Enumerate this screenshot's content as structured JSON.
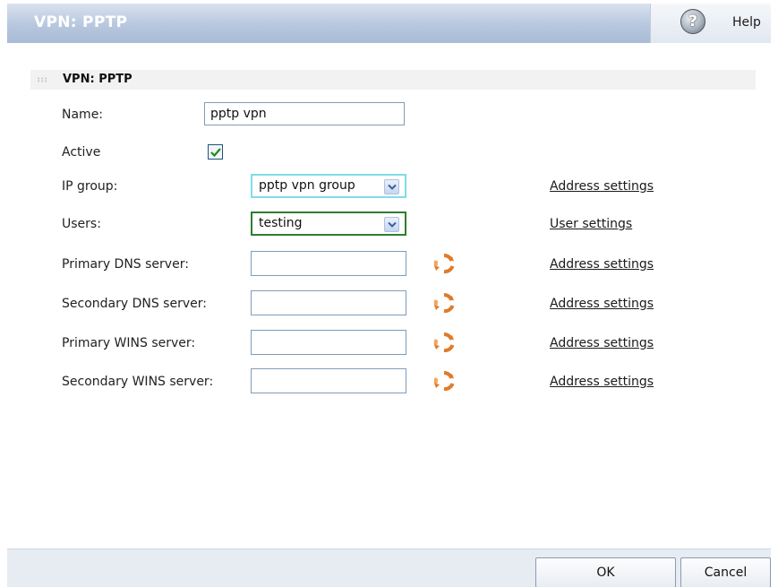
{
  "window": {
    "title": "VPN: PPTP",
    "help_label": "Help",
    "help_icon": "question-mark-icon"
  },
  "section": {
    "title": "VPN: PPTP"
  },
  "form": {
    "name_label": "Name:",
    "name_value": "pptp vpn",
    "active_label": "Active",
    "active_checked": true,
    "ip_group_label": "IP group:",
    "ip_group_value": "pptp vpn group",
    "users_label": "Users:",
    "users_value": "testing",
    "primary_dns_label": "Primary DNS server:",
    "primary_dns_value": "",
    "secondary_dns_label": "Secondary DNS server:",
    "secondary_dns_value": "",
    "primary_wins_label": "Primary WINS server:",
    "primary_wins_value": "",
    "secondary_wins_label": "Secondary WINS server:",
    "secondary_wins_value": ""
  },
  "links": {
    "ip_group": "Address settings",
    "users": "User settings",
    "primary_dns": "Address settings",
    "secondary_dns": "Address settings",
    "primary_wins": "Address settings",
    "secondary_wins": "Address settings"
  },
  "footer": {
    "ok_label": "OK",
    "cancel_label": "Cancel"
  },
  "colors": {
    "title_bar": "#b7c7de",
    "ip_group_focus": "#7fdcea",
    "users_border": "#2f7d2f",
    "refresh_icon": "#e07b2a"
  }
}
